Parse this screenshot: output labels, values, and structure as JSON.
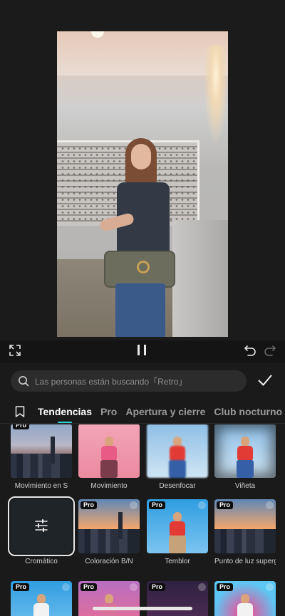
{
  "player": {
    "controls": {
      "fullscreen": "fullscreen-icon",
      "pause": "pause-icon",
      "undo": "undo-icon",
      "redo": "redo-icon"
    }
  },
  "search": {
    "placeholder": "Las personas están buscando「Retro」",
    "icon": "search-icon"
  },
  "confirm_icon": "checkmark-icon",
  "tabs": [
    {
      "label": "Tendencias",
      "active": true
    },
    {
      "label": "Pro",
      "active": false
    },
    {
      "label": "Apertura y cierre",
      "active": false
    },
    {
      "label": "Club nocturno",
      "active": false
    }
  ],
  "effects": [
    {
      "label": "Movimiento en S",
      "pro": true
    },
    {
      "label": "Movimiento",
      "pro": false
    },
    {
      "label": "Desenfocar",
      "pro": false
    },
    {
      "label": "Viñeta",
      "pro": false
    },
    {
      "label": "Cromático",
      "pro": false,
      "selected": true
    },
    {
      "label": "Coloración B/N",
      "pro": true
    },
    {
      "label": "Temblor",
      "pro": true
    },
    {
      "label": "Punto de luz supergr",
      "pro": true
    },
    {
      "label": "",
      "pro": true
    },
    {
      "label": "",
      "pro": true
    },
    {
      "label": "",
      "pro": true
    },
    {
      "label": "",
      "pro": true
    }
  ],
  "pro_badge": "Pro",
  "colors": {
    "accent": "#2ed4d0",
    "background": "#141414",
    "sheet": "#1a1a1a"
  }
}
